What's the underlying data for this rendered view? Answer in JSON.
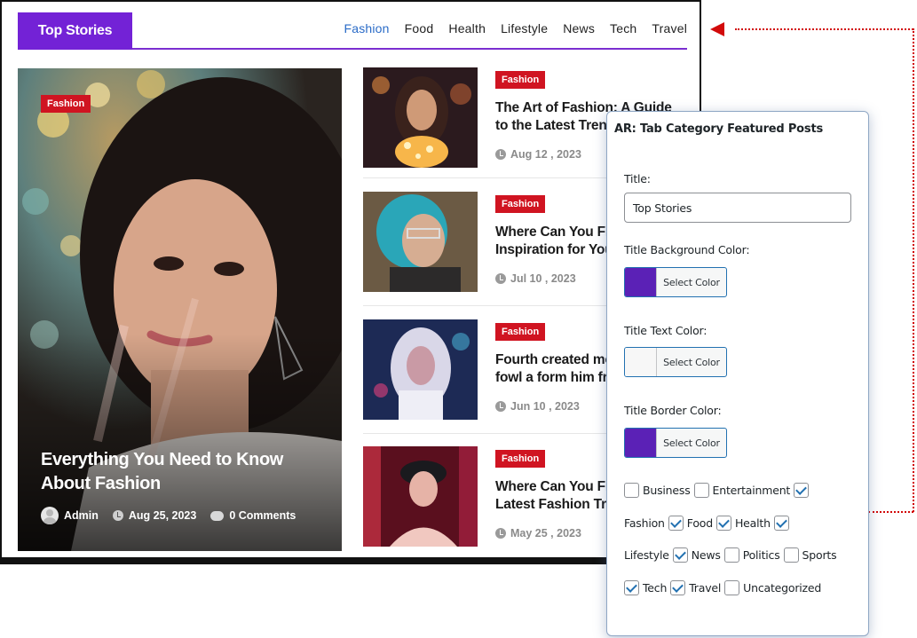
{
  "preview": {
    "title": "Top Stories",
    "tabs": [
      {
        "label": "Fashion",
        "active": true
      },
      {
        "label": "Food",
        "active": false
      },
      {
        "label": "Health",
        "active": false
      },
      {
        "label": "Lifestyle",
        "active": false
      },
      {
        "label": "News",
        "active": false
      },
      {
        "label": "Tech",
        "active": false
      },
      {
        "label": "Travel",
        "active": false
      }
    ],
    "featured": {
      "badge": "Fashion",
      "title": "Everything You Need to Know About Fashion",
      "author": "Admin",
      "date": "Aug 25, 2023",
      "comments": "0 Comments"
    },
    "posts": [
      {
        "badge": "Fashion",
        "title_line1": "The Art of Fashion: A Guide",
        "title_line2": "to the Latest Trends",
        "date": "Aug 12 , 2023"
      },
      {
        "badge": "Fashion",
        "title_line1": "Where Can You Find",
        "title_line2": "Inspiration for Your Style",
        "date": "Jul 10 , 2023"
      },
      {
        "badge": "Fashion",
        "title_line1": "Fourth created moving",
        "title_line2": "fowl a form him fruit",
        "date": "Jun 10 , 2023"
      },
      {
        "badge": "Fashion",
        "title_line1": "Where Can You Find the",
        "title_line2": "Latest Fashion Trends",
        "date": "May 25 , 2023"
      }
    ]
  },
  "panel": {
    "heading": "AR: Tab Category Featured Posts",
    "title_label": "Title:",
    "title_value": "Top Stories",
    "bg_color_label": "Title Background Color:",
    "text_color_label": "Title Text Color:",
    "border_color_label": "Title Border Color:",
    "select_color": "Select Color",
    "colors": {
      "background": "#5b21b6",
      "text": "#f7f7f7",
      "border": "#5b21b6"
    },
    "categories": [
      {
        "label": "Business",
        "checked": false
      },
      {
        "label": "Entertainment",
        "checked": false
      },
      {
        "label": "Fashion",
        "checked": true
      },
      {
        "label": "Food",
        "checked": true
      },
      {
        "label": "Health",
        "checked": true
      },
      {
        "label": "Lifestyle",
        "checked": true
      },
      {
        "label": "News",
        "checked": true
      },
      {
        "label": "Politics",
        "checked": false
      },
      {
        "label": "Sports",
        "checked": false
      },
      {
        "label": "Tech",
        "checked": true
      },
      {
        "label": "Travel",
        "checked": true
      },
      {
        "label": "Uncategorized",
        "checked": false
      }
    ]
  }
}
